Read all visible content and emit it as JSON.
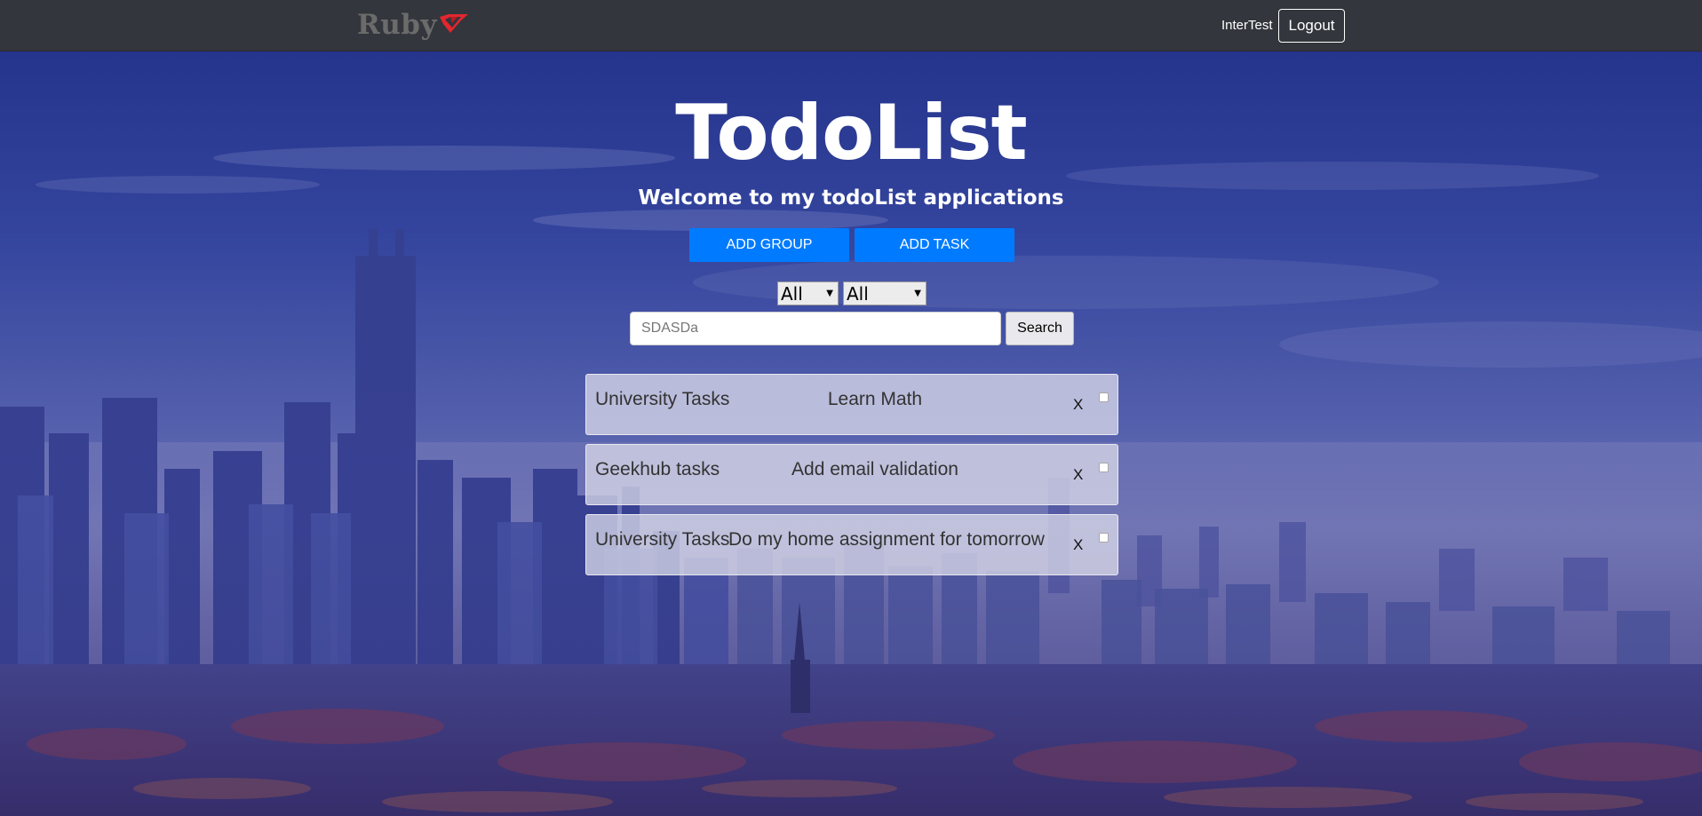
{
  "navbar": {
    "logo_text": "Ruby",
    "logo_color": "#e3262f",
    "user_name": "InterTest",
    "logout_label": "Logout"
  },
  "header": {
    "title": "TodoList",
    "subtitle": "Welcome to my todoList applications"
  },
  "actions": {
    "add_group_label": "ADD GROUP",
    "add_task_label": "ADD TASK",
    "accent_color": "#007bff"
  },
  "filters": {
    "group_selected": "All",
    "status_selected": "All"
  },
  "search": {
    "value": "SDASDa",
    "button_label": "Search"
  },
  "tasks": [
    {
      "group": "University Tasks",
      "name": "Learn Math",
      "delete_label": "X",
      "done": false
    },
    {
      "group": "Geekhub tasks",
      "name": "Add email validation",
      "delete_label": "X",
      "done": false
    },
    {
      "group": "University Tasks",
      "name": "Do my home assignment for tomorrow",
      "delete_label": "X",
      "done": false
    }
  ]
}
